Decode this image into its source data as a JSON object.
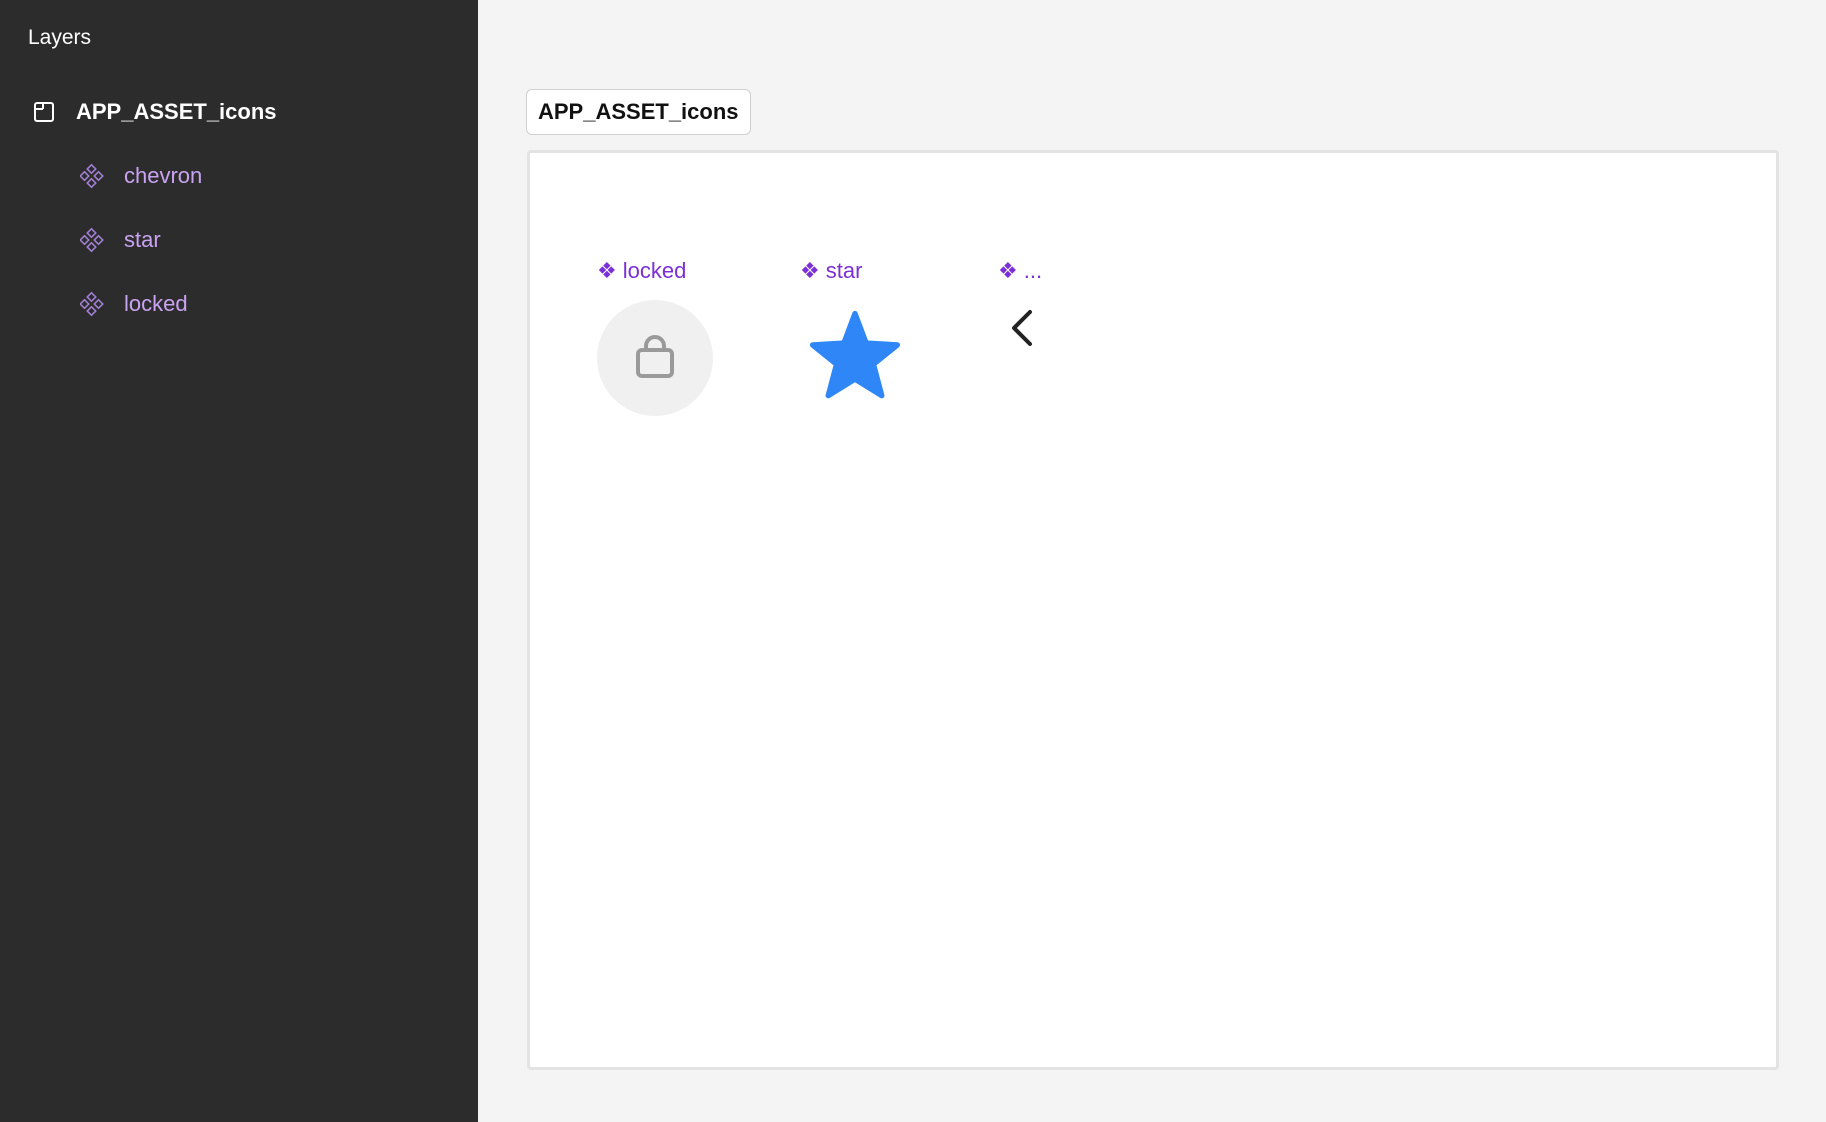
{
  "sidebar": {
    "title": "Layers",
    "frame": {
      "label": "APP_ASSET_icons",
      "icon": "frame-icon"
    },
    "components": [
      {
        "label": "chevron",
        "icon": "component-icon"
      },
      {
        "label": "star",
        "icon": "component-icon"
      },
      {
        "label": "locked",
        "icon": "component-icon"
      }
    ]
  },
  "canvas": {
    "frame_tab": "APP_ASSET_icons",
    "components": [
      {
        "glyph": "❖",
        "label": "locked",
        "icon": "lock-icon"
      },
      {
        "glyph": "❖",
        "label": "star",
        "icon": "star-icon"
      },
      {
        "glyph": "❖",
        "label": "...",
        "icon": "chevron-left-icon"
      }
    ]
  },
  "colors": {
    "sidebar_bg": "#2c2c2c",
    "component_label": "#c9a3f2",
    "component_tag": "#7b2fd6",
    "star_fill": "#2f86f6",
    "lock_stroke": "#9a9a9a",
    "lock_bg": "#f0f0f0",
    "chevron_stroke": "#222222"
  }
}
